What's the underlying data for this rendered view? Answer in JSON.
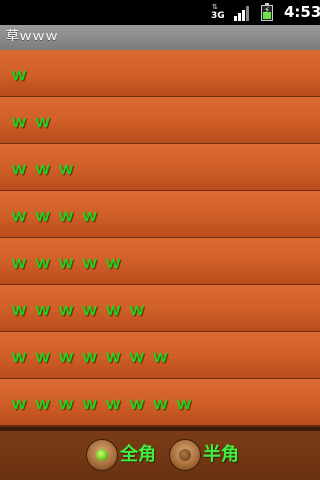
{
  "status_bar": {
    "network_arrows": "⇅",
    "network_type": "3G",
    "time": "4:53",
    "battery_level": 0.6
  },
  "title_bar": {
    "title": "草ｗｗｗ"
  },
  "list": {
    "items": [
      {
        "label": "ｗ"
      },
      {
        "label": "ｗ ｗ"
      },
      {
        "label": "ｗ ｗ ｗ"
      },
      {
        "label": "ｗ ｗ ｗ ｗ"
      },
      {
        "label": "ｗ ｗ ｗ ｗ ｗ"
      },
      {
        "label": "ｗ ｗ ｗ ｗ ｗ ｗ"
      },
      {
        "label": "ｗ ｗ ｗ ｗ ｗ ｗ ｗ"
      },
      {
        "label": "ｗ ｗ ｗ ｗ ｗ ｗ ｗ ｗ"
      }
    ]
  },
  "bottom_bar": {
    "options": [
      {
        "label": "全角",
        "selected": true
      },
      {
        "label": "半角",
        "selected": false
      }
    ]
  },
  "colors": {
    "row_gradient_top": "#dc6a33",
    "row_gradient_bottom": "#b84c1c",
    "text_green": "#1fd41f",
    "title_bar_gray": "#8a8a8a"
  }
}
